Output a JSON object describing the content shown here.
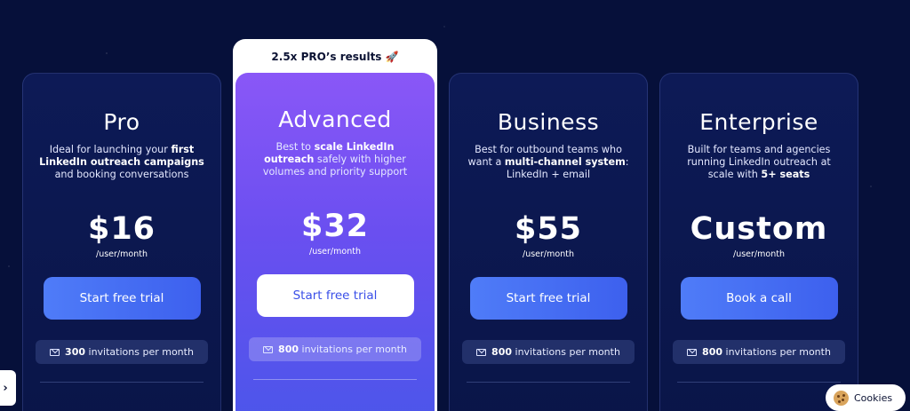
{
  "plans": [
    {
      "name": "Pro",
      "desc_parts": [
        "Ideal for launching your ",
        "first LinkedIn outreach campaigns",
        " and booking conversations"
      ],
      "price": "$16",
      "period": "/user/month",
      "cta": "Start free trial",
      "invites_count": "300",
      "invites_text": "invitations per month"
    },
    {
      "banner": "2.5x PRO’s results 🚀",
      "name": "Advanced",
      "desc_parts": [
        "Best to ",
        "scale LinkedIn outreach",
        " safely with higher volumes and priority support"
      ],
      "price": "$32",
      "period": "/user/month",
      "cta": "Start free trial",
      "invites_count": "800",
      "invites_text": "invitations per month"
    },
    {
      "name": "Business",
      "desc_parts": [
        "Best for outbound teams who want a ",
        "multi-channel system",
        ": LinkedIn + email"
      ],
      "price": "$55",
      "period": "/user/month",
      "cta": "Start free trial",
      "invites_count": "800",
      "invites_text": "invitations per month"
    },
    {
      "name": "Enterprise",
      "desc_parts": [
        "Built for teams and agencies running LinkedIn outreach at scale with ",
        "5+ seats",
        ""
      ],
      "price": "Custom",
      "period": "/user/month",
      "cta": "Book a call",
      "invites_count": "800",
      "invites_text": "invitations per month"
    }
  ],
  "side_tab": {
    "icon": "chevron-right-icon",
    "glyph": "›"
  },
  "cookies": {
    "icon": "cookie-icon",
    "label": "Cookies"
  },
  "colors": {
    "background": "#06103a",
    "card": "#0d1a56",
    "accent": "#4f7cf8",
    "advanced_gradient_top": "#8a57f7",
    "advanced_gradient_bottom": "#4b56ea"
  }
}
